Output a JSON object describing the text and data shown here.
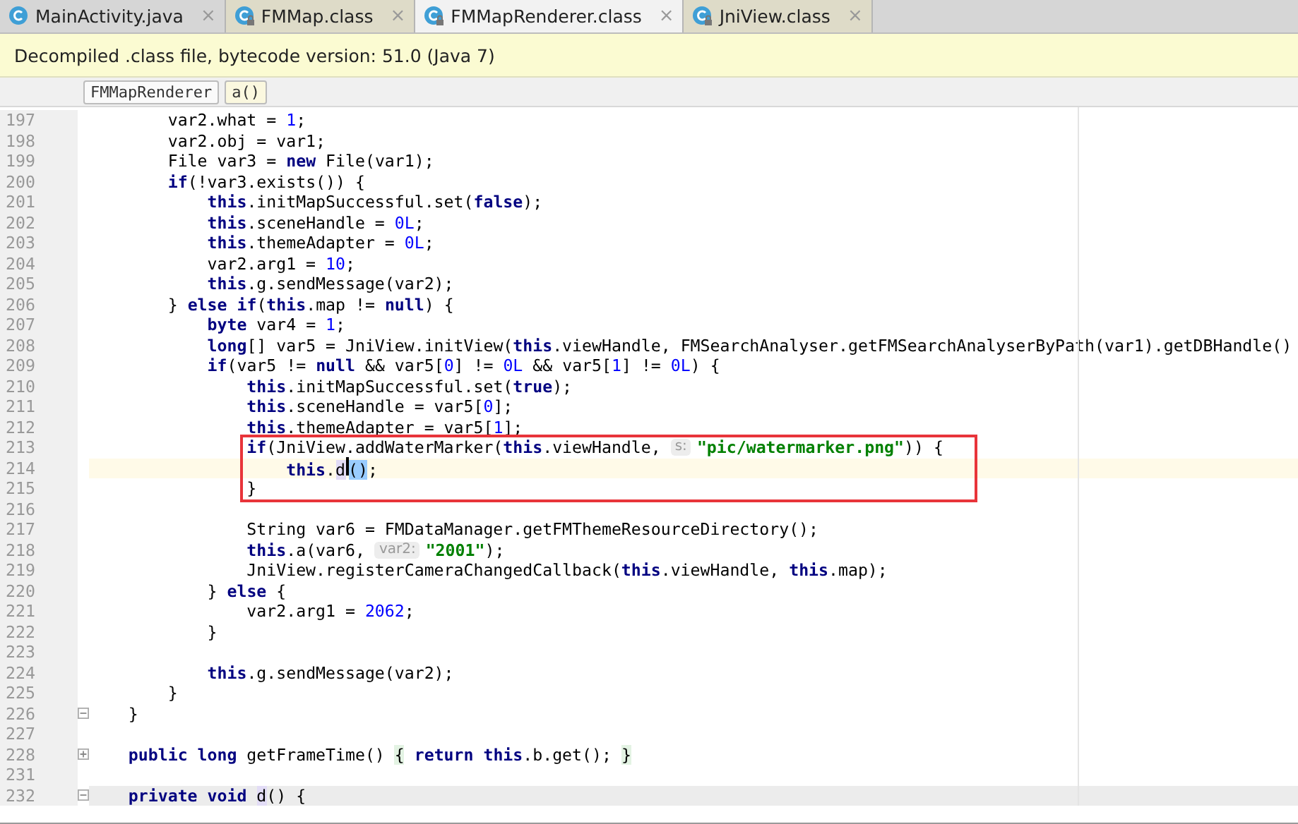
{
  "tabs": [
    {
      "label": "MainActivity.java",
      "kind": "java",
      "selected": false,
      "close": "×"
    },
    {
      "label": "FMMap.class",
      "kind": "class",
      "selected": false,
      "close": "×"
    },
    {
      "label": "FMMapRenderer.class",
      "kind": "class",
      "selected": true,
      "close": "×"
    },
    {
      "label": "JniView.class",
      "kind": "class",
      "selected": false,
      "close": "×"
    }
  ],
  "banner": "Decompiled .class file, bytecode version: 51.0 (Java 7)",
  "breadcrumbs": [
    {
      "label": "FMMapRenderer",
      "selected": false
    },
    {
      "label": "a()",
      "selected": true
    }
  ],
  "lines": [
    {
      "number": "197",
      "tokens": [
        "        var2.what = ",
        {
          "kind": "number",
          "text": "1"
        },
        ";"
      ]
    },
    {
      "number": "198",
      "tokens": [
        "        var2.obj = var1;"
      ]
    },
    {
      "number": "199",
      "tokens": [
        "        File var3 = ",
        {
          "kind": "keyword",
          "text": "new"
        },
        " File(var1);"
      ]
    },
    {
      "number": "200",
      "tokens": [
        {
          "kind": "keyword",
          "text": "        if"
        },
        "(!var3.exists()) {"
      ]
    },
    {
      "number": "201",
      "tokens": [
        {
          "kind": "keyword",
          "text": "            this"
        },
        ".initMapSuccessful.set(",
        {
          "kind": "keyword",
          "text": "false"
        },
        ");"
      ]
    },
    {
      "number": "202",
      "tokens": [
        {
          "kind": "keyword",
          "text": "            this"
        },
        ".sceneHandle = ",
        {
          "kind": "number",
          "text": "0L"
        },
        ";"
      ]
    },
    {
      "number": "203",
      "tokens": [
        {
          "kind": "keyword",
          "text": "            this"
        },
        ".themeAdapter = ",
        {
          "kind": "number",
          "text": "0L"
        },
        ";"
      ]
    },
    {
      "number": "204",
      "tokens": [
        "            var2.arg1 = ",
        {
          "kind": "number",
          "text": "10"
        },
        ";"
      ]
    },
    {
      "number": "205",
      "tokens": [
        {
          "kind": "keyword",
          "text": "            this"
        },
        ".g.sendMessage(var2);"
      ]
    },
    {
      "number": "206",
      "tokens": [
        "        } ",
        {
          "kind": "keyword",
          "text": "else if"
        },
        "(",
        {
          "kind": "keyword",
          "text": "this"
        },
        ".map != ",
        {
          "kind": "keyword",
          "text": "null"
        },
        ") {"
      ]
    },
    {
      "number": "207",
      "tokens": [
        {
          "kind": "keyword",
          "text": "            byte"
        },
        " var4 = ",
        {
          "kind": "number",
          "text": "1"
        },
        ";"
      ]
    },
    {
      "number": "208",
      "tokens": [
        {
          "kind": "keyword",
          "text": "            long"
        },
        "[] var5 = JniView.initView(",
        {
          "kind": "keyword",
          "text": "this"
        },
        ".viewHandle, FMSearchAnalyser.getFMSearchAnalyserByPath(var1).getDBHandle()"
      ]
    },
    {
      "number": "209",
      "tokens": [
        {
          "kind": "keyword",
          "text": "            if"
        },
        "(var5 != ",
        {
          "kind": "keyword",
          "text": "null"
        },
        " && var5[",
        {
          "kind": "number",
          "text": "0"
        },
        "] != ",
        {
          "kind": "number",
          "text": "0L"
        },
        " && var5[",
        {
          "kind": "number",
          "text": "1"
        },
        "] != ",
        {
          "kind": "number",
          "text": "0L"
        },
        ") {"
      ]
    },
    {
      "number": "210",
      "tokens": [
        {
          "kind": "keyword",
          "text": "                this"
        },
        ".initMapSuccessful.set(",
        {
          "kind": "keyword",
          "text": "true"
        },
        ");"
      ]
    },
    {
      "number": "211",
      "tokens": [
        {
          "kind": "keyword",
          "text": "                this"
        },
        ".sceneHandle = var5[",
        {
          "kind": "number",
          "text": "0"
        },
        "];"
      ]
    },
    {
      "number": "212",
      "tokens": [
        {
          "kind": "keyword",
          "text": "                this"
        },
        ".themeAdapter = var5[",
        {
          "kind": "number",
          "text": "1"
        },
        "];"
      ]
    },
    {
      "number": "213",
      "boxed": true,
      "tokens": [
        {
          "kind": "keyword",
          "text": "                if"
        },
        "(JniView.addWaterMarker(",
        {
          "kind": "keyword",
          "text": "this"
        },
        ".viewHandle, ",
        {
          "kind": "hint",
          "text": "s:"
        },
        {
          "kind": "string",
          "text": "\"pic/watermarker.png\""
        },
        ")) {"
      ]
    },
    {
      "number": "214",
      "boxed": true,
      "current": true,
      "tokens": [
        {
          "kind": "keyword",
          "text": "                    this"
        },
        ".",
        {
          "kind": "usage",
          "text": "d"
        },
        {
          "kind": "caret"
        },
        {
          "kind": "match",
          "text": "()"
        },
        ";"
      ]
    },
    {
      "number": "215",
      "boxed": true,
      "tokens": [
        "                }"
      ]
    },
    {
      "number": "216"
    },
    {
      "number": "217",
      "tokens": [
        "                String var6 = FMDataManager.getFMThemeResourceDirectory();"
      ]
    },
    {
      "number": "218",
      "tokens": [
        {
          "kind": "keyword",
          "text": "                this"
        },
        ".a(var6, ",
        {
          "kind": "hint",
          "text": "var2:"
        },
        {
          "kind": "string",
          "text": "\"2001\""
        },
        ");"
      ]
    },
    {
      "number": "219",
      "tokens": [
        "                JniView.registerCameraChangedCallback(",
        {
          "kind": "keyword",
          "text": "this"
        },
        ".viewHandle, ",
        {
          "kind": "keyword",
          "text": "this"
        },
        ".map);"
      ]
    },
    {
      "number": "220",
      "tokens": [
        "            } ",
        {
          "kind": "keyword",
          "text": "else"
        },
        " {"
      ]
    },
    {
      "number": "221",
      "tokens": [
        "                var2.arg1 = ",
        {
          "kind": "number",
          "text": "2062"
        },
        ";"
      ]
    },
    {
      "number": "222",
      "tokens": [
        "            }"
      ]
    },
    {
      "number": "223"
    },
    {
      "number": "224",
      "tokens": [
        {
          "kind": "keyword",
          "text": "            this"
        },
        ".g.sendMessage(var2);"
      ]
    },
    {
      "number": "225",
      "tokens": [
        "        }"
      ]
    },
    {
      "number": "226",
      "expanded": true,
      "tokens": [
        "    }"
      ]
    },
    {
      "number": "227"
    },
    {
      "number": "228",
      "expanded": false,
      "tokens": [
        {
          "kind": "keyword",
          "text": "    public long"
        },
        " getFrameTime() ",
        {
          "kind": "folded",
          "text": "{"
        },
        {
          "kind": "keyword",
          "text": " return this"
        },
        ".b.get(); ",
        {
          "kind": "folded",
          "text": "}"
        }
      ]
    },
    {
      "number": "231"
    },
    {
      "number": "232",
      "expanded": true,
      "marked": true,
      "tokens": [
        {
          "kind": "keyword",
          "text": "    private void "
        },
        {
          "kind": "usage",
          "text": "d"
        },
        "() {"
      ]
    }
  ]
}
